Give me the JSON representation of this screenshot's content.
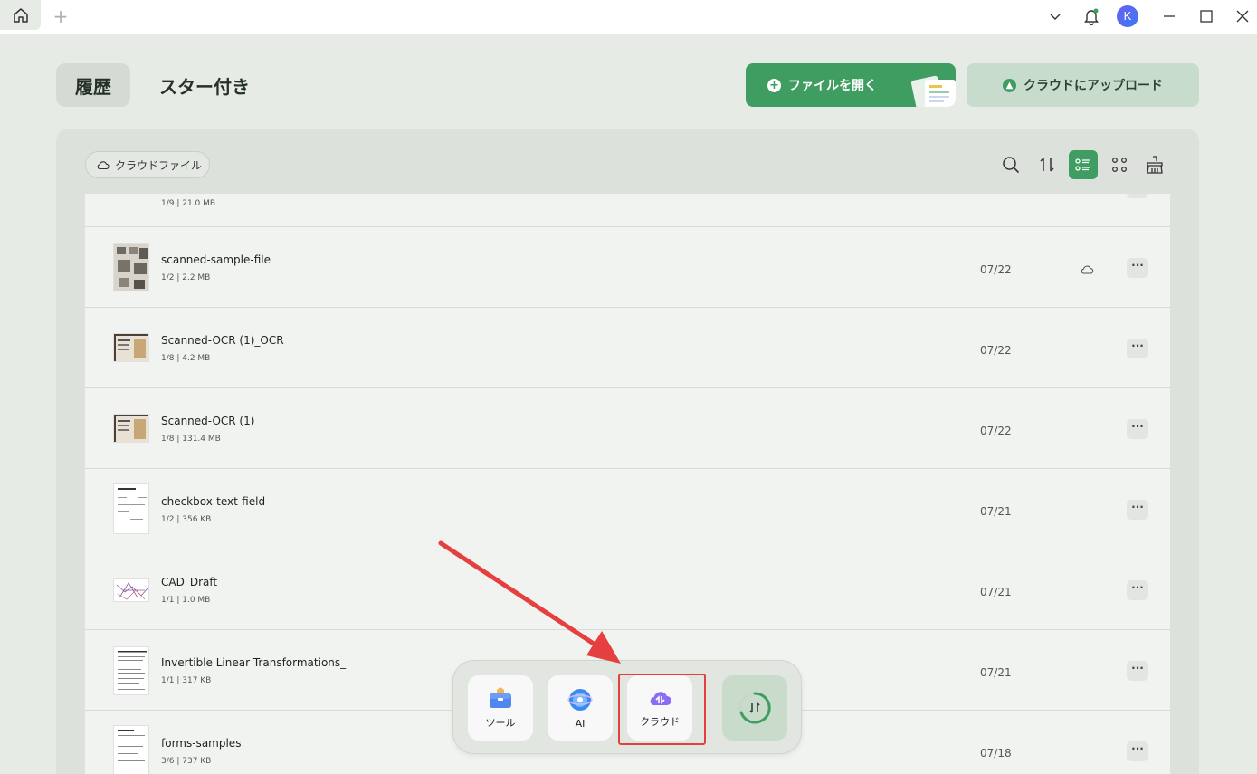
{
  "tabs": {
    "history": "履歴",
    "starred": "スター付き"
  },
  "actions": {
    "open_file": "ファイルを開く",
    "upload_cloud": "クラウドにアップロード"
  },
  "filter": {
    "cloud_files": "クラウドファイル"
  },
  "files": [
    {
      "name": "",
      "meta": "1/9 | 21.0 MB",
      "date": ""
    },
    {
      "name": "scanned-sample-file",
      "meta": "1/2 | 2.2 MB",
      "date": "07/22",
      "cloud": true
    },
    {
      "name": "Scanned-OCR (1)_OCR",
      "meta": "1/8 | 4.2 MB",
      "date": "07/22"
    },
    {
      "name": "Scanned-OCR (1)",
      "meta": "1/8 | 131.4 MB",
      "date": "07/22"
    },
    {
      "name": "checkbox-text-field",
      "meta": "1/2 | 356 KB",
      "date": "07/21"
    },
    {
      "name": "CAD_Draft",
      "meta": "1/1 | 1.0 MB",
      "date": "07/21"
    },
    {
      "name": "Invertible Linear Transformations_",
      "meta": "1/1 | 317 KB",
      "date": "07/21"
    },
    {
      "name": "forms-samples",
      "meta": "3/6 | 737 KB",
      "date": "07/18"
    }
  ],
  "dock": {
    "tools": "ツール",
    "ai": "AI",
    "cloud": "クラウド"
  },
  "user": {
    "avatar_letter": "K"
  },
  "more_symbol": "···",
  "colors": {
    "accent": "#3f9d61",
    "highlight": "#e53f3f"
  }
}
